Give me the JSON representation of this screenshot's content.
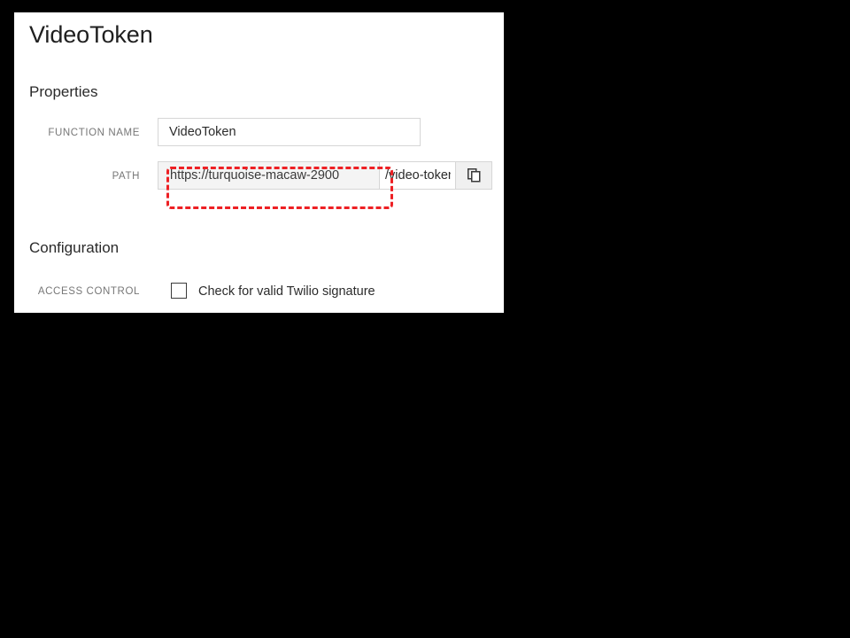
{
  "panel": {
    "title": "VideoToken"
  },
  "sections": {
    "properties": {
      "heading": "Properties",
      "function_name": {
        "label": "FUNCTION NAME",
        "value": "VideoToken"
      },
      "path": {
        "label": "PATH",
        "prefix_value": "https://turquoise-macaw-2900",
        "suffix_value": "/video-token",
        "copy_icon": "copy-icon"
      }
    },
    "configuration": {
      "heading": "Configuration",
      "access_control": {
        "label": "ACCESS CONTROL",
        "checkbox_label": "Check for valid Twilio signature",
        "checked": false
      }
    }
  },
  "annotation": {
    "color": "#ed2024",
    "target": "path-prefix"
  }
}
